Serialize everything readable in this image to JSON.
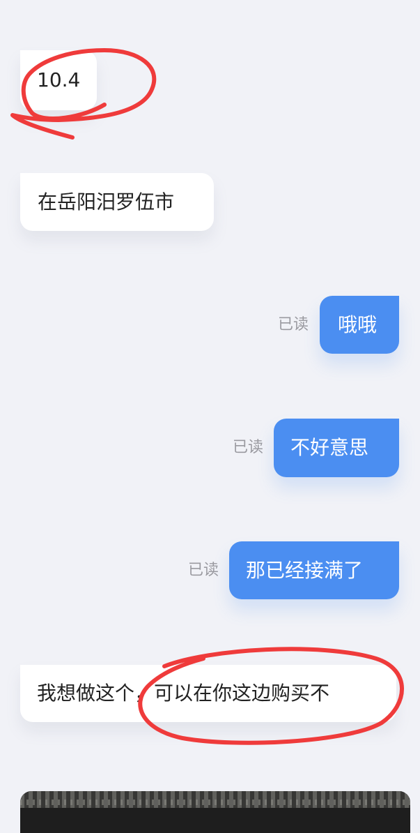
{
  "messages": [
    {
      "side": "incoming",
      "text": "10.4"
    },
    {
      "side": "incoming",
      "text": "在岳阳汨罗伍市"
    },
    {
      "side": "outgoing",
      "text": "哦哦",
      "status": "已读"
    },
    {
      "side": "outgoing",
      "text": "不好意思",
      "status": "已读"
    },
    {
      "side": "outgoing",
      "text": "那已经接满了",
      "status": "已读"
    },
    {
      "side": "incoming",
      "text": "我想做这个，可以在你这边购买不"
    }
  ],
  "colors": {
    "background": "#f1f2f7",
    "incoming_bubble": "#ffffff",
    "outgoing_bubble": "#4b8ef1",
    "read_receipt": "#9a9aa0",
    "annotation": "#ef3b3b"
  },
  "image_message": {
    "icon": "image-thumbnail"
  }
}
